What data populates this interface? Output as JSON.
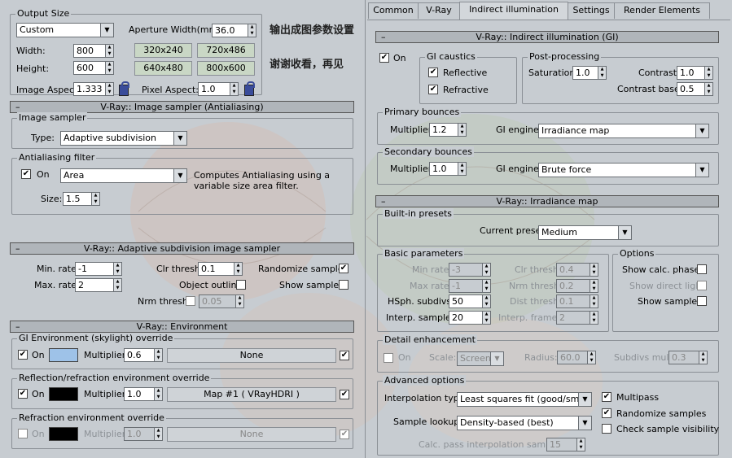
{
  "colors": {
    "panel": "#c7ccd1",
    "rollout": "#b0b5ba",
    "resBtn": "#c9d7c5",
    "lock": "#3a4c9a",
    "skySwatch": "#9ec2e8",
    "blackSwatch": "#000000"
  },
  "annotations": {
    "line1": "输出成图参数设置",
    "line2": "谢谢收看，再见"
  },
  "output": {
    "title": "Output Size",
    "preset": "Custom",
    "aperture_label": "Aperture Width(mm):",
    "aperture_value": "36.0",
    "width_label": "Width:",
    "width_value": "800",
    "height_label": "Height:",
    "height_value": "600",
    "presets": [
      "320x240",
      "720x486",
      "640x480",
      "800x600"
    ],
    "image_aspect_label": "Image Aspect:",
    "image_aspect_value": "1.333",
    "pixel_aspect_label": "Pixel Aspect:",
    "pixel_aspect_value": "1.0"
  },
  "image_sampler": {
    "rollout": "V-Ray:: Image sampler (Antialiasing)",
    "group": "Image sampler",
    "type_label": "Type:",
    "type_value": "Adaptive subdivision",
    "aa_group": "Antialiasing filter",
    "on_label": "On",
    "filter_value": "Area",
    "description": "Computes Antialiasing using a variable size area filter.",
    "size_label": "Size:",
    "size_value": "1.5"
  },
  "adaptive": {
    "rollout": "V-Ray:: Adaptive subdivision image sampler",
    "min_rate_label": "Min. rate:",
    "min_rate_value": "-1",
    "max_rate_label": "Max. rate:",
    "max_rate_value": "2",
    "clr_thresh_label": "Clr thresh:",
    "clr_thresh_value": "0.1",
    "object_outline_label": "Object outline",
    "nrm_thresh_label": "Nrm thresh:",
    "nrm_thresh_value": "0.05",
    "randomize_label": "Randomize samples",
    "show_samples_label": "Show samples"
  },
  "environment": {
    "rollout": "V-Ray:: Environment",
    "gi_group": "GI Environment (skylight) override",
    "gi_on": "On",
    "gi_mult_label": "Multiplier:",
    "gi_mult_value": "0.6",
    "gi_map": "None",
    "refl_group": "Reflection/refraction environment override",
    "refl_on": "On",
    "refl_mult_label": "Multiplier:",
    "refl_mult_value": "1.0",
    "refl_map": "Map #1  ( VRayHDRI )",
    "refr_group": "Refraction environment override",
    "refr_on": "On",
    "refr_mult_label": "Multiplier:",
    "refr_mult_value": "1.0",
    "refr_map": "None"
  },
  "tabs": [
    "Common",
    "V-Ray",
    "Indirect illumination",
    "Settings",
    "Render Elements"
  ],
  "gi": {
    "rollout": "V-Ray:: Indirect illumination (GI)",
    "on_label": "On",
    "caustics_group": "GI caustics",
    "reflective_label": "Reflective",
    "refractive_label": "Refractive",
    "post_group": "Post-processing",
    "saturation_label": "Saturation:",
    "saturation_value": "1.0",
    "contrast_label": "Contrast:",
    "contrast_value": "1.0",
    "contrast_base_label": "Contrast base:",
    "contrast_base_value": "0.5",
    "primary_group": "Primary bounces",
    "primary_mult_label": "Multiplier:",
    "primary_mult_value": "1.2",
    "primary_engine_label": "GI engine:",
    "primary_engine_value": "Irradiance map",
    "secondary_group": "Secondary bounces",
    "secondary_mult_label": "Multiplier:",
    "secondary_mult_value": "1.0",
    "secondary_engine_label": "GI engine:",
    "secondary_engine_value": "Brute force"
  },
  "irradiance": {
    "rollout": "V-Ray:: Irradiance map",
    "presets_group": "Built-in presets",
    "current_preset_label": "Current preset:",
    "current_preset_value": "Medium",
    "basic_group": "Basic parameters",
    "min_rate_label": "Min rate:",
    "min_rate_value": "-3",
    "max_rate_label": "Max rate:",
    "max_rate_value": "-1",
    "hsph_label": "HSph. subdivs:",
    "hsph_value": "50",
    "interp_samples_label": "Interp. samples:",
    "interp_samples_value": "20",
    "clr_thresh_label": "Clr thresh:",
    "clr_thresh_value": "0.4",
    "nrm_thresh_label": "Nrm thresh:",
    "nrm_thresh_value": "0.2",
    "dist_thresh_label": "Dist thresh:",
    "dist_thresh_value": "0.1",
    "interp_frames_label": "Interp. frames:",
    "interp_frames_value": "2",
    "options_group": "Options",
    "show_calc_label": "Show calc. phase",
    "show_direct_label": "Show direct light",
    "show_samples_label": "Show samples",
    "detail_group": "Detail enhancement",
    "detail_on_label": "On",
    "scale_label": "Scale:",
    "scale_value": "Screen",
    "radius_label": "Radius:",
    "radius_value": "60.0",
    "subdivs_mult_label": "Subdivs mult.",
    "subdivs_mult_value": "0.3",
    "advanced_group": "Advanced options",
    "interp_type_label": "Interpolation type:",
    "interp_type_value": "Least squares fit (good/smooth",
    "multipass_label": "Multipass",
    "randomize_label": "Randomize samples",
    "check_label": "Check sample visibility",
    "sample_lookup_label": "Sample lookup:",
    "sample_lookup_value": "Density-based (best)",
    "calc_pass_label": "Calc. pass interpolation samples:",
    "calc_pass_value": "15"
  }
}
